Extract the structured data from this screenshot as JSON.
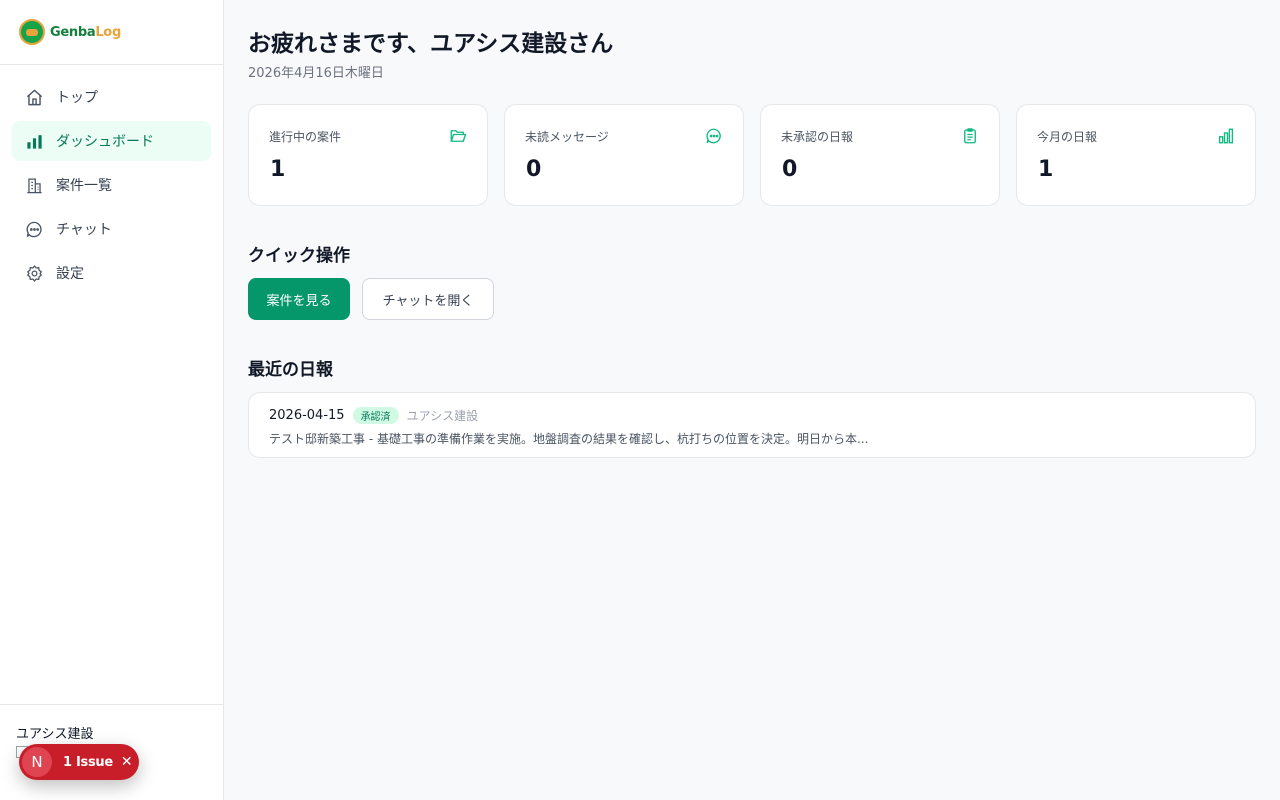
{
  "app": {
    "logo_part1": "Genba",
    "logo_part2": "Log"
  },
  "colors": {
    "accent": "#059669",
    "accent_light": "#ecfdf5",
    "issue_red": "#c81e2a"
  },
  "sidebar": {
    "items": [
      {
        "label": "トップ",
        "icon": "home-icon"
      },
      {
        "label": "ダッシュボード",
        "icon": "bar-chart-icon",
        "active": true
      },
      {
        "label": "案件一覧",
        "icon": "building-icon"
      },
      {
        "label": "チャット",
        "icon": "chat-bubble-icon"
      },
      {
        "label": "設定",
        "icon": "gear-icon"
      }
    ],
    "footer": {
      "company": "ユアシス建設"
    }
  },
  "issue_pill": {
    "avatar": "N",
    "label": "1 Issue",
    "close": "✕"
  },
  "header": {
    "greeting": "お疲れさまです、ユアシス建設さん",
    "date": "2026年4月16日木曜日"
  },
  "stats": [
    {
      "label": "進行中の案件",
      "value": "1",
      "icon": "folder-icon"
    },
    {
      "label": "未読メッセージ",
      "value": "0",
      "icon": "message-icon"
    },
    {
      "label": "未承認の日報",
      "value": "0",
      "icon": "clipboard-icon"
    },
    {
      "label": "今月の日報",
      "value": "1",
      "icon": "bar-chart-icon"
    }
  ],
  "quick_actions": {
    "title": "クイック操作",
    "primary": "案件を見る",
    "secondary": "チャットを開く"
  },
  "recent_reports": {
    "title": "最近の日報",
    "items": [
      {
        "date": "2026-04-15",
        "status": "承認済",
        "company": "ユアシス建設",
        "summary": "テスト邸新築工事 - 基礎工事の準備作業を実施。地盤調査の結果を確認し、杭打ちの位置を決定。明日から本..."
      }
    ]
  }
}
